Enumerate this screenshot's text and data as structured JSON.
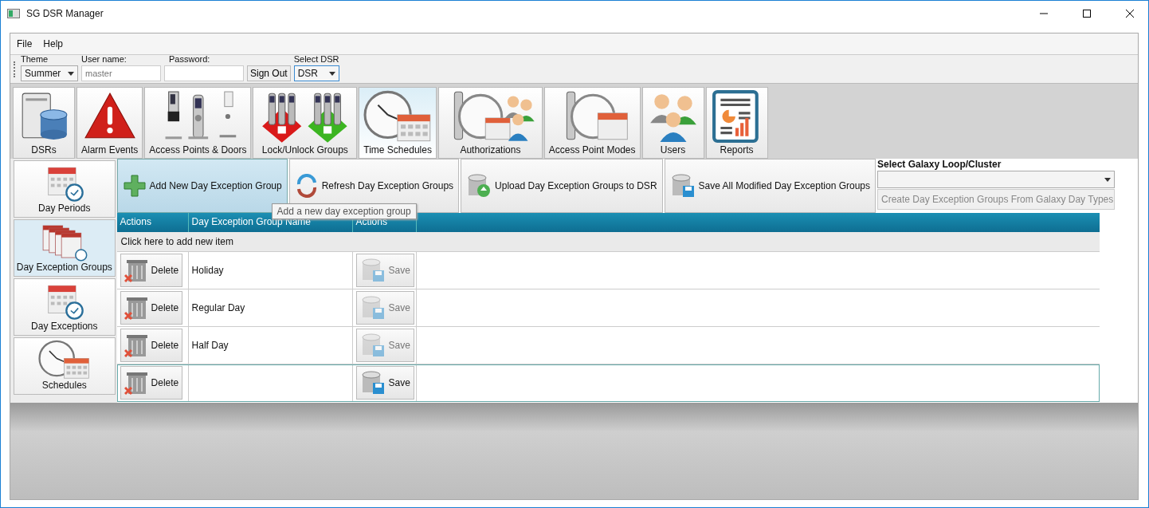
{
  "window": {
    "title": "SG DSR Manager"
  },
  "menu": [
    "File",
    "Help"
  ],
  "toolbar": {
    "theme": {
      "label": "Theme",
      "value": "Summer"
    },
    "username": {
      "label": "User name:",
      "placeholder": "master"
    },
    "password": {
      "label": "Password:"
    },
    "sign_out": "Sign Out",
    "dsr": {
      "label": "Select DSR",
      "value": "DSR"
    }
  },
  "modules": [
    {
      "label": "DSRs",
      "kind": "server",
      "selected": false
    },
    {
      "label": "Alarm Events",
      "kind": "alarm",
      "selected": false
    },
    {
      "label": "Access Points & Doors",
      "kind": "locks",
      "selected": false
    },
    {
      "label": "Lock/Unlock Groups",
      "kind": "lockgroups",
      "selected": false
    },
    {
      "label": "Time Schedules",
      "kind": "clockcal",
      "selected": true
    },
    {
      "label": "Authorizations",
      "kind": "auth",
      "selected": false
    },
    {
      "label": "Access Point Modes",
      "kind": "lockclock",
      "selected": false
    },
    {
      "label": "Users",
      "kind": "users",
      "selected": false
    },
    {
      "label": "Reports",
      "kind": "report",
      "selected": false
    }
  ],
  "sidebar": {
    "items": [
      {
        "label": "Day Periods",
        "kind": "calclock",
        "selected": false
      },
      {
        "label": "Day Exception Groups",
        "kind": "calendars",
        "selected": true
      },
      {
        "label": "Day Exceptions",
        "kind": "calclock",
        "selected": false
      },
      {
        "label": "Schedules",
        "kind": "clockcal",
        "selected": false
      }
    ]
  },
  "actions": [
    {
      "label": "Add New Day Exception Group",
      "kind": "plus",
      "highlighted": true,
      "tooltip": "Add a new day exception group"
    },
    {
      "label": "Refresh Day Exception Groups",
      "kind": "refresh",
      "highlighted": false
    },
    {
      "label": "Upload Day Exception Groups to DSR",
      "kind": "upload",
      "highlighted": false
    },
    {
      "label": "Save All Modified Day Exception Groups",
      "kind": "save",
      "highlighted": false
    }
  ],
  "galaxy": {
    "label": "Select Galaxy Loop/Cluster",
    "create_button": {
      "label": "Create Day Exception Groups From Galaxy Day Types",
      "disabled": true
    }
  },
  "table": {
    "columns": [
      "Actions",
      "Day Exception Group Name",
      "Actions"
    ],
    "new_item_row": "Click here to add new item",
    "rows": [
      {
        "delete": "Delete",
        "name": "Holiday",
        "save": "Save",
        "save_disabled": true,
        "selected": false
      },
      {
        "delete": "Delete",
        "name": "Regular Day",
        "save": "Save",
        "save_disabled": true,
        "selected": false
      },
      {
        "delete": "Delete",
        "name": "Half Day",
        "save": "Save",
        "save_disabled": true,
        "selected": false
      },
      {
        "delete": "Delete",
        "save": "Save",
        "save_disabled": false,
        "selected": true
      }
    ]
  }
}
